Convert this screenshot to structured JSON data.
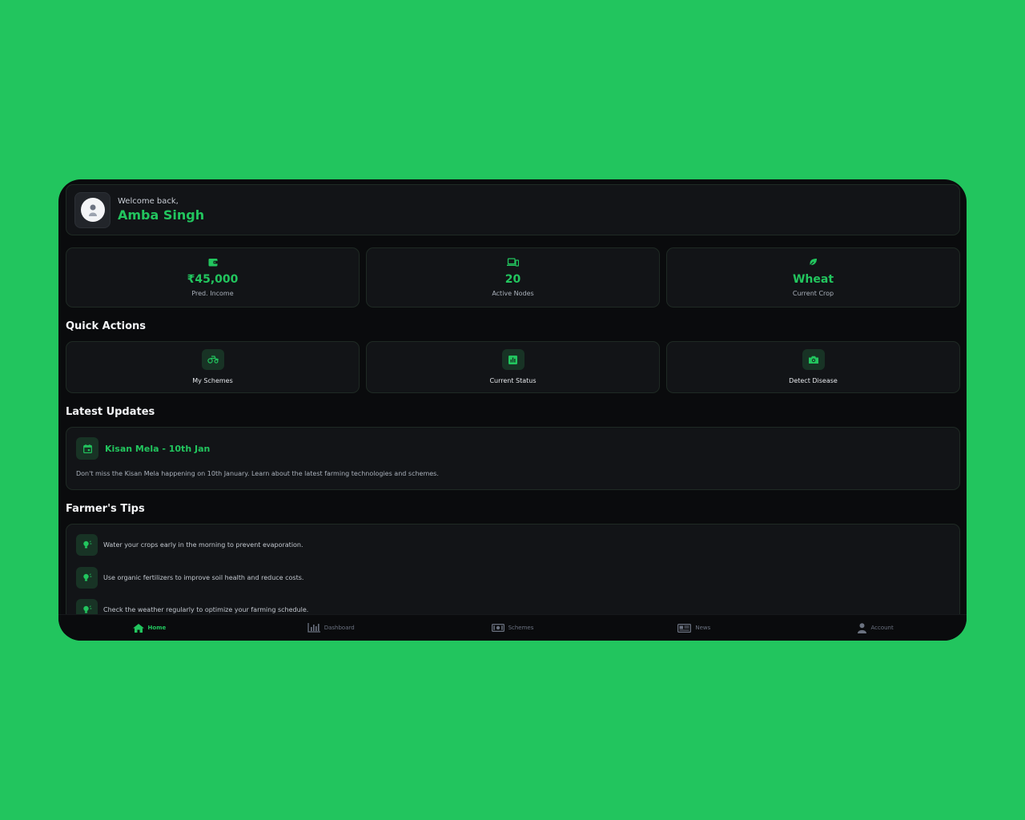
{
  "header": {
    "welcome": "Welcome back,",
    "name": "Amba Singh"
  },
  "stats": [
    {
      "icon": "wallet-icon",
      "value": "₹45,000",
      "label": "Pred. Income"
    },
    {
      "icon": "devices-icon",
      "value": "20",
      "label": "Active Nodes"
    },
    {
      "icon": "leaf-icon",
      "value": "Wheat",
      "label": "Current Crop"
    }
  ],
  "quick_actions": {
    "title": "Quick Actions",
    "items": [
      {
        "icon": "tractor-icon",
        "label": "My Schemes"
      },
      {
        "icon": "chart-icon",
        "label": "Current Status"
      },
      {
        "icon": "camera-icon",
        "label": "Detect Disease"
      }
    ]
  },
  "latest_updates": {
    "title": "Latest Updates",
    "items": [
      {
        "icon": "calendar-icon",
        "title": "Kisan Mela - 10th Jan",
        "body": "Don't miss the Kisan Mela happening on 10th January. Learn about the latest farming technologies and schemes."
      }
    ]
  },
  "tips": {
    "title": "Farmer's Tips",
    "items": [
      "Water your crops early in the morning to prevent evaporation.",
      "Use organic fertilizers to improve soil health and reduce costs.",
      "Check the weather regularly to optimize your farming schedule."
    ]
  },
  "nav": {
    "items": [
      {
        "icon": "home-icon",
        "label": "Home",
        "active": true
      },
      {
        "icon": "bar-chart-icon",
        "label": "Dashboard",
        "active": false
      },
      {
        "icon": "money-icon",
        "label": "Schemes",
        "active": false
      },
      {
        "icon": "newspaper-icon",
        "label": "News",
        "active": false
      },
      {
        "icon": "user-icon",
        "label": "Account",
        "active": false
      }
    ]
  },
  "colors": {
    "accent": "#22c55e",
    "background": "#0a0b0d",
    "card": "#121417",
    "page_bg": "#22c55e"
  }
}
